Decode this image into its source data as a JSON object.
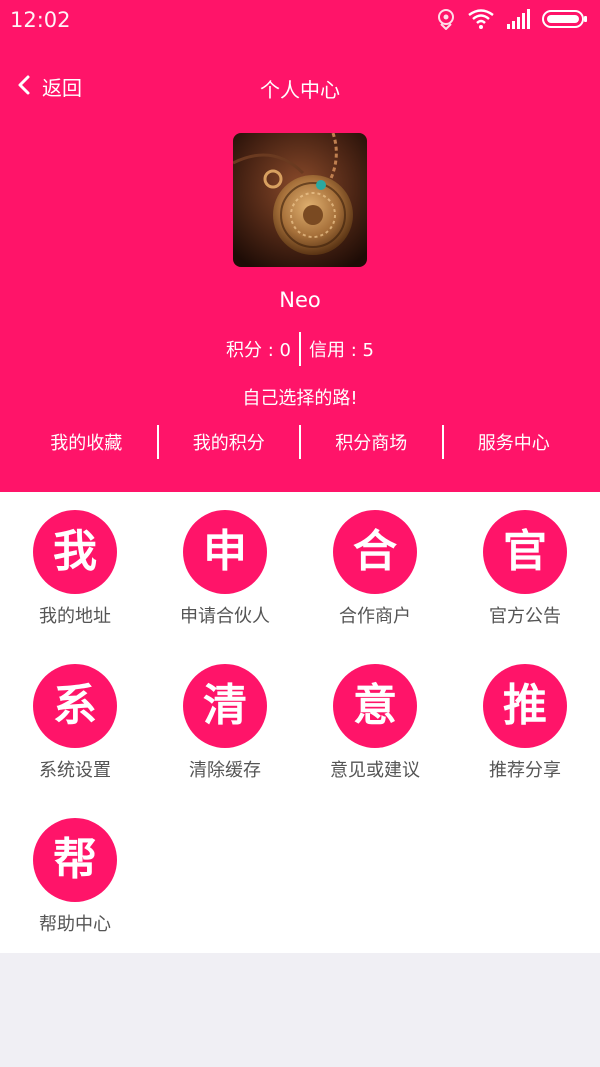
{
  "status_bar": {
    "time": "12:02"
  },
  "navbar": {
    "back_label": "返回",
    "title": "个人中心"
  },
  "profile": {
    "username": "Neo",
    "points_label": "积分 : 0",
    "credit_label": "信用 : 5",
    "signature": "自己选择的路!"
  },
  "links": [
    {
      "label": "我的收藏"
    },
    {
      "label": "我的积分"
    },
    {
      "label": "积分商场"
    },
    {
      "label": "服务中心"
    }
  ],
  "grid": [
    {
      "glyph": "我",
      "label": "我的地址"
    },
    {
      "glyph": "申",
      "label": "申请合伙人"
    },
    {
      "glyph": "合",
      "label": "合作商户"
    },
    {
      "glyph": "官",
      "label": "官方公告"
    },
    {
      "glyph": "系",
      "label": "系统设置"
    },
    {
      "glyph": "清",
      "label": "清除缓存"
    },
    {
      "glyph": "意",
      "label": "意见或建议"
    },
    {
      "glyph": "推",
      "label": "推荐分享"
    },
    {
      "glyph": "帮",
      "label": "帮助中心"
    }
  ],
  "colors": {
    "accent": "#ff1469",
    "panel": "#ffffff",
    "background": "#f0eff4",
    "label_text": "#555555"
  },
  "icons": [
    "location-off-icon",
    "wifi-icon",
    "signal-icon",
    "battery-icon",
    "back-arrow-icon"
  ]
}
